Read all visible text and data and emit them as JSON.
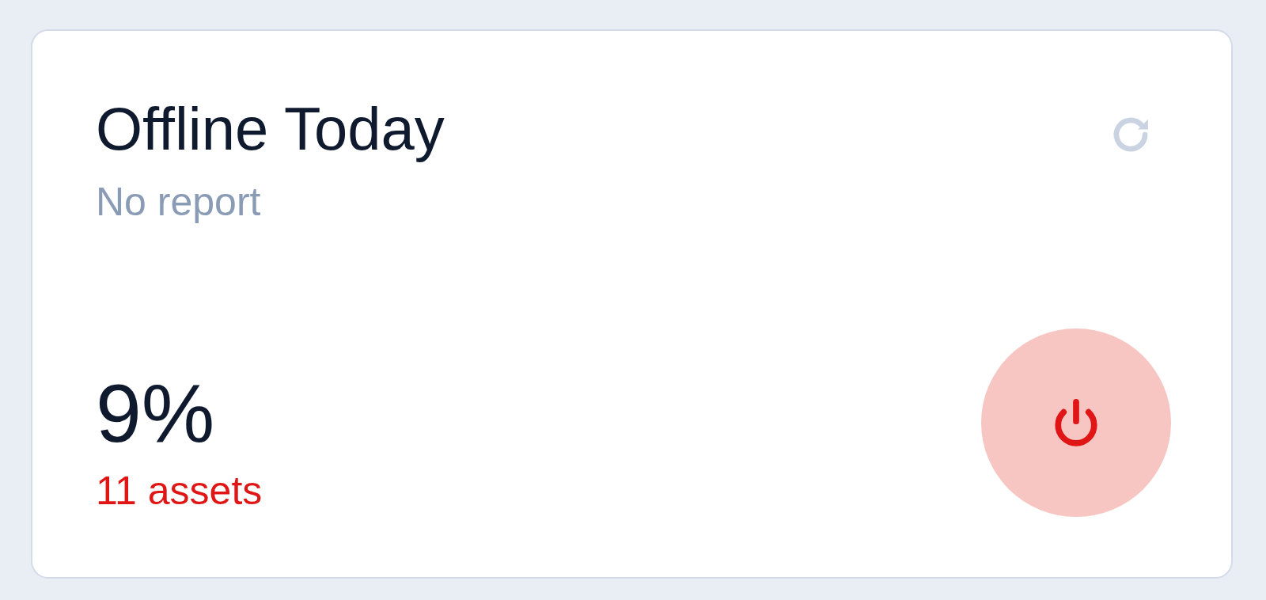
{
  "card": {
    "title": "Offline Today",
    "subtitle": "No report",
    "value": "9%",
    "detail": "11 assets"
  }
}
